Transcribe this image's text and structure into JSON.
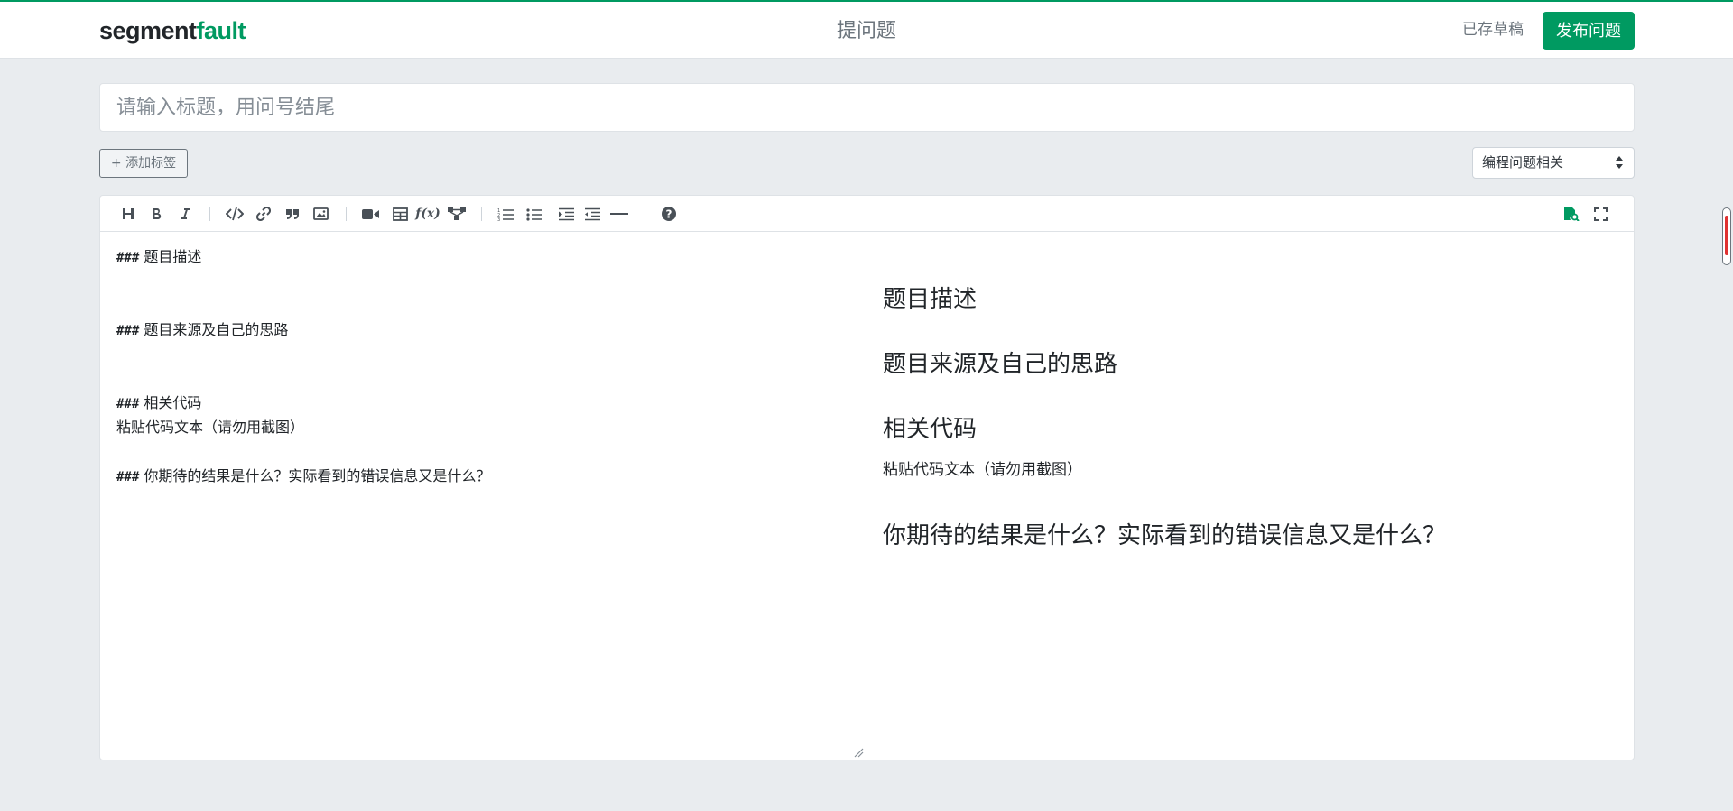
{
  "header": {
    "logo_part1": "segment",
    "logo_part2": "fault",
    "title": "提问题",
    "draft_status": "已存草稿",
    "publish_label": "发布问题",
    "accent_color": "#009a61"
  },
  "title_field": {
    "value": "",
    "placeholder": "请输入标题，用问号结尾"
  },
  "tags": {
    "add_label": "+ 添加标签"
  },
  "category": {
    "selected": "编程问题相关"
  },
  "toolbar": {
    "icons": [
      "heading-icon",
      "bold-icon",
      "italic-icon",
      "code-icon",
      "link-icon",
      "quote-icon",
      "image-icon",
      "video-icon",
      "table-icon",
      "formula-icon",
      "flowchart-icon",
      "ordered-list-icon",
      "unordered-list-icon",
      "indent-icon",
      "outdent-icon",
      "horizontal-rule-icon",
      "help-icon",
      "preview-toggle-icon",
      "fullscreen-icon"
    ],
    "formula_glyph": "f(x)"
  },
  "source": {
    "hash": "###",
    "h1": " 题目描述",
    "h2": " 题目来源及自己的思路",
    "h3": " 相关代码",
    "p3": "粘贴代码文本（请勿用截图）",
    "h4": " 你期待的结果是什么？实际看到的错误信息又是什么？"
  },
  "preview": {
    "h1": "题目描述",
    "h2": "题目来源及自己的思路",
    "h3": "相关代码",
    "p3": "粘贴代码文本（请勿用截图）",
    "h4": "你期待的结果是什么？实际看到的错误信息又是什么？"
  }
}
